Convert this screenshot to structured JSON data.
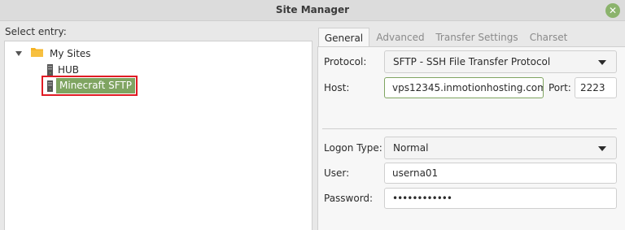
{
  "window": {
    "title": "Site Manager",
    "close_glyph": "✕"
  },
  "left": {
    "select_label": "Select entry:",
    "tree": {
      "root": {
        "label": "My Sites",
        "icon": "folder-icon"
      },
      "children": [
        {
          "label": "HUB",
          "icon": "server-icon"
        },
        {
          "label": "Minecraft SFTP",
          "icon": "server-icon",
          "selected": true
        }
      ]
    }
  },
  "tabs": [
    {
      "label": "General",
      "active": true
    },
    {
      "label": "Advanced",
      "active": false
    },
    {
      "label": "Transfer Settings",
      "active": false
    },
    {
      "label": "Charset",
      "active": false
    }
  ],
  "general": {
    "protocol_label": "Protocol:",
    "protocol_value": "SFTP - SSH File Transfer Protocol",
    "host_label": "Host:",
    "host_value": "vps12345.inmotionhosting.com",
    "port_label": "Port:",
    "port_value": "2223",
    "logon_type_label": "Logon Type:",
    "logon_type_value": "Normal",
    "user_label": "User:",
    "user_value": "userna01",
    "password_label": "Password:",
    "password_value": "••••••••••••"
  },
  "colors": {
    "accent": "#7fa461",
    "highlight_box": "#e01b24",
    "folder": "#f5b324"
  }
}
